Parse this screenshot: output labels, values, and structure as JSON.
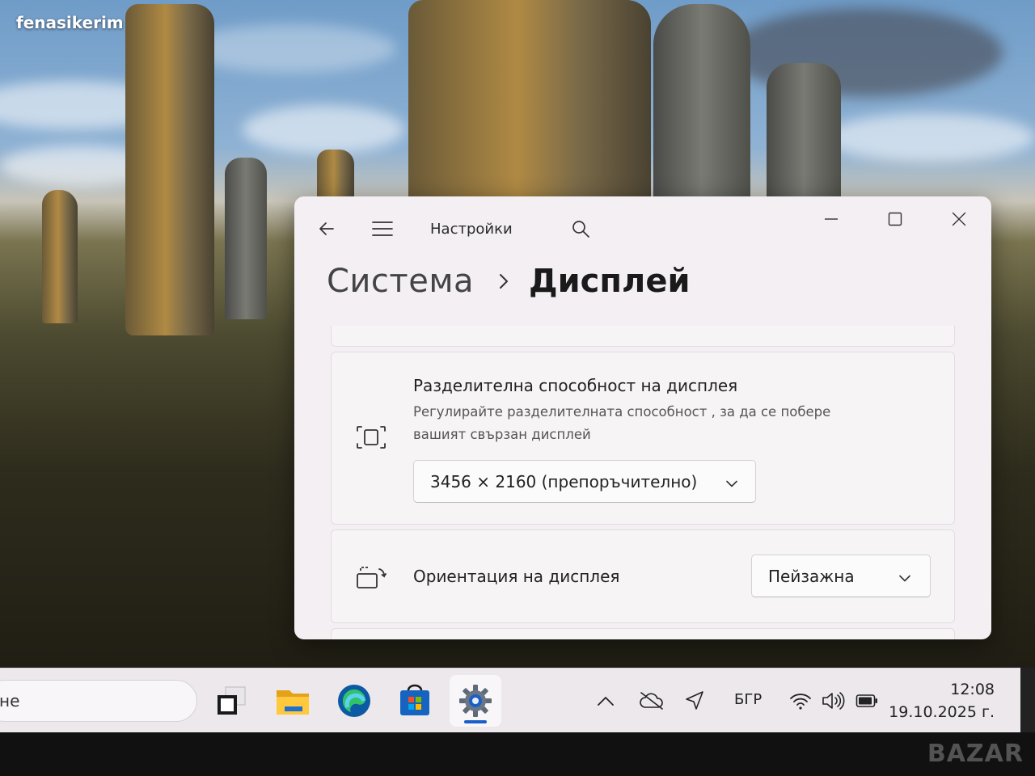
{
  "wallpaper": {
    "brand_text": "fenasikerim"
  },
  "window": {
    "app_title": "Настройки",
    "breadcrumb": {
      "parent": "Система",
      "separator": "›",
      "current": "Дисплей"
    },
    "resolution_card": {
      "title": "Разделителна способност на дисплея",
      "description": "Регулирайте разделителната способност , за да се побере вашият свързан дисплей",
      "selected_value": "3456 × 2160 (препоръчително)",
      "icon": "resolution-icon"
    },
    "orientation_card": {
      "title": "Ориентация на дисплея",
      "selected_value": "Пейзажна",
      "icon": "orientation-icon"
    }
  },
  "taskbar": {
    "search_text": "не",
    "apps": [
      "task-view",
      "file-explorer",
      "edge",
      "microsoft-store",
      "settings"
    ],
    "active_app": "settings",
    "language": "БГР",
    "time": "12:08",
    "date": "19.10.2025 г."
  },
  "watermark_text": "BAZAR",
  "colors": {
    "accent": "#1a5fc8",
    "window_bg": "#f3eff2",
    "taskbar_bg": "#ece8ec"
  }
}
